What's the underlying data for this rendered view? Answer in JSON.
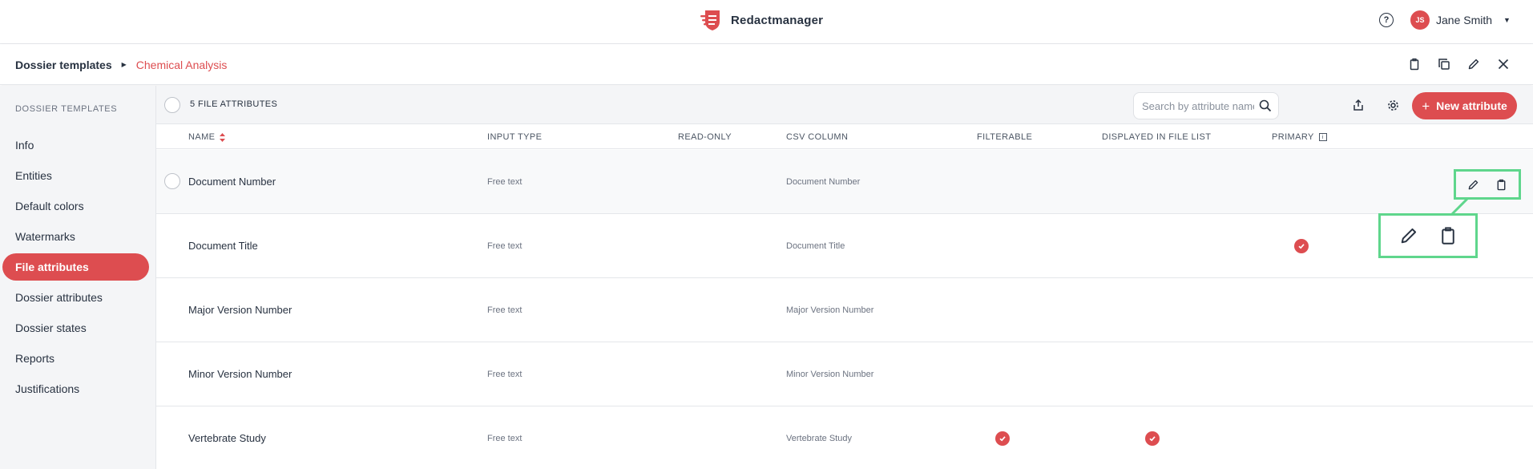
{
  "app": {
    "name": "Redactmanager"
  },
  "header": {
    "help_symbol": "?",
    "user_initials": "JS",
    "user_name": "Jane Smith"
  },
  "breadcrumb": {
    "root": "Dossier templates",
    "current": "Chemical Analysis"
  },
  "sidebar": {
    "title": "DOSSIER TEMPLATES",
    "items": [
      {
        "label": "Info",
        "active": false
      },
      {
        "label": "Entities",
        "active": false
      },
      {
        "label": "Default colors",
        "active": false
      },
      {
        "label": "Watermarks",
        "active": false
      },
      {
        "label": "File attributes",
        "active": true
      },
      {
        "label": "Dossier attributes",
        "active": false
      },
      {
        "label": "Dossier states",
        "active": false
      },
      {
        "label": "Reports",
        "active": false
      },
      {
        "label": "Justifications",
        "active": false
      }
    ]
  },
  "toolbar": {
    "count_label": "5 FILE ATTRIBUTES",
    "search_placeholder": "Search by attribute name...",
    "new_button_label": "New attribute",
    "new_button_symbol": "+"
  },
  "table": {
    "columns": [
      "NAME",
      "INPUT TYPE",
      "READ-ONLY",
      "CSV COLUMN",
      "FILTERABLE",
      "DISPLAYED IN FILE LIST",
      "PRIMARY"
    ],
    "rows": [
      {
        "name": "Document Number",
        "input_type": "Free text",
        "read_only": false,
        "csv_column": "Document Number",
        "filterable": false,
        "displayed": false,
        "primary": false
      },
      {
        "name": "Document Title",
        "input_type": "Free text",
        "read_only": false,
        "csv_column": "Document Title",
        "filterable": false,
        "displayed": false,
        "primary": true
      },
      {
        "name": "Major Version Number",
        "input_type": "Free text",
        "read_only": false,
        "csv_column": "Major Version Number",
        "filterable": false,
        "displayed": false,
        "primary": false
      },
      {
        "name": "Minor Version Number",
        "input_type": "Free text",
        "read_only": false,
        "csv_column": "Minor Version Number",
        "filterable": false,
        "displayed": false,
        "primary": false
      },
      {
        "name": "Vertebrate Study",
        "input_type": "Free text",
        "read_only": false,
        "csv_column": "Vertebrate Study",
        "filterable": true,
        "displayed": true,
        "primary": false
      }
    ]
  },
  "colors": {
    "accent": "#dd4d50",
    "highlight": "#5fd68c",
    "text": "#283241",
    "sidebar_bg": "#f4f5f7"
  }
}
